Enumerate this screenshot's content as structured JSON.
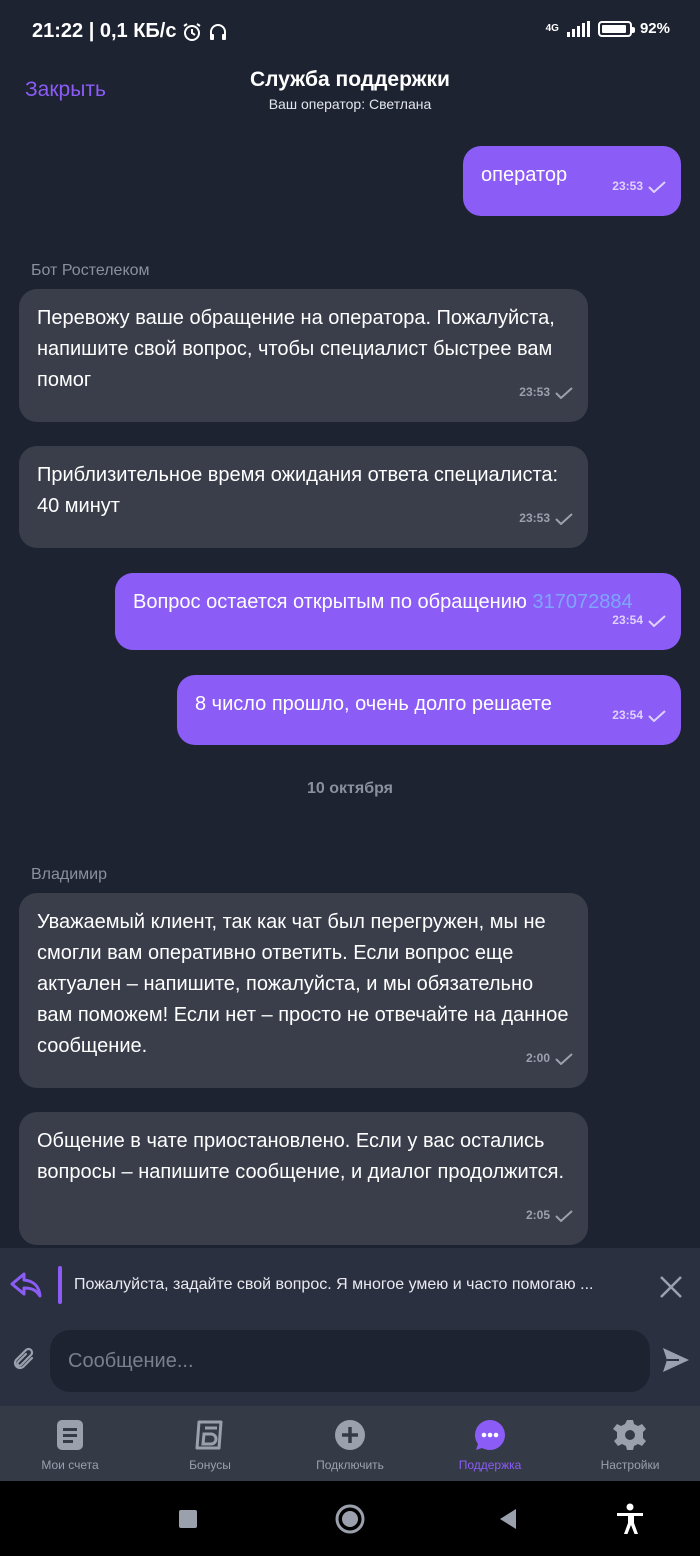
{
  "status": {
    "time_speed": "21:22 | 0,1 КБ/с",
    "network": "4G",
    "battery_percent": 92,
    "battery_label": "92%"
  },
  "header": {
    "close_label": "Закрыть",
    "title": "Служба поддержки",
    "subtitle": "Ваш оператор: Светлана"
  },
  "messages": [
    {
      "text": "оператор",
      "time": "23:53"
    },
    {
      "sender": "Бот Ростелеком",
      "text": "Перевожу ваше обращение на оператора. Пожалуйста, напишите свой вопрос, чтобы специалист  быстрее вам помог",
      "time": "23:53"
    },
    {
      "text": "Приблизительное время ожидания ответа специалиста: 40 минут",
      "time": "23:53"
    },
    {
      "text": "Вопрос остается открытым по обращению ",
      "link": "317072884",
      "time": "23:54"
    },
    {
      "text": "8 число прошло, очень долго решаете",
      "time": "23:54"
    },
    {
      "sender": "Владимир",
      "text": "Уважаемый клиент, так как чат был перегружен, мы не смогли вам оперативно ответить. Если вопрос еще актуален – напишите, пожалуйста, и мы обязательно вам поможем! Если нет – просто не отвечайте на данное сообщение.",
      "time": "2:00"
    },
    {
      "text": "Общение в чате приостановлено. Если у вас остались вопросы – напишите сообщение, и диалог продолжится.",
      "time": "2:05"
    }
  ],
  "day_separator": "10 октября",
  "reply_preview": "Пожалуйста, задайте свой вопрос. Я многое умею и часто помогаю ...",
  "composer": {
    "placeholder": "Сообщение..."
  },
  "tabs": [
    {
      "label": "Мои счета",
      "icon": "document-icon"
    },
    {
      "label": "Бонусы",
      "icon": "bonus-icon"
    },
    {
      "label": "Подключить",
      "icon": "plus-icon"
    },
    {
      "label": "Поддержка",
      "icon": "chat-icon",
      "active": true
    },
    {
      "label": "Настройки",
      "icon": "gear-icon"
    }
  ],
  "colors": {
    "accent": "#8b5cf6",
    "background": "#1d2331",
    "incoming_bubble": "#3a3e4b",
    "link": "#7fa6ff"
  }
}
